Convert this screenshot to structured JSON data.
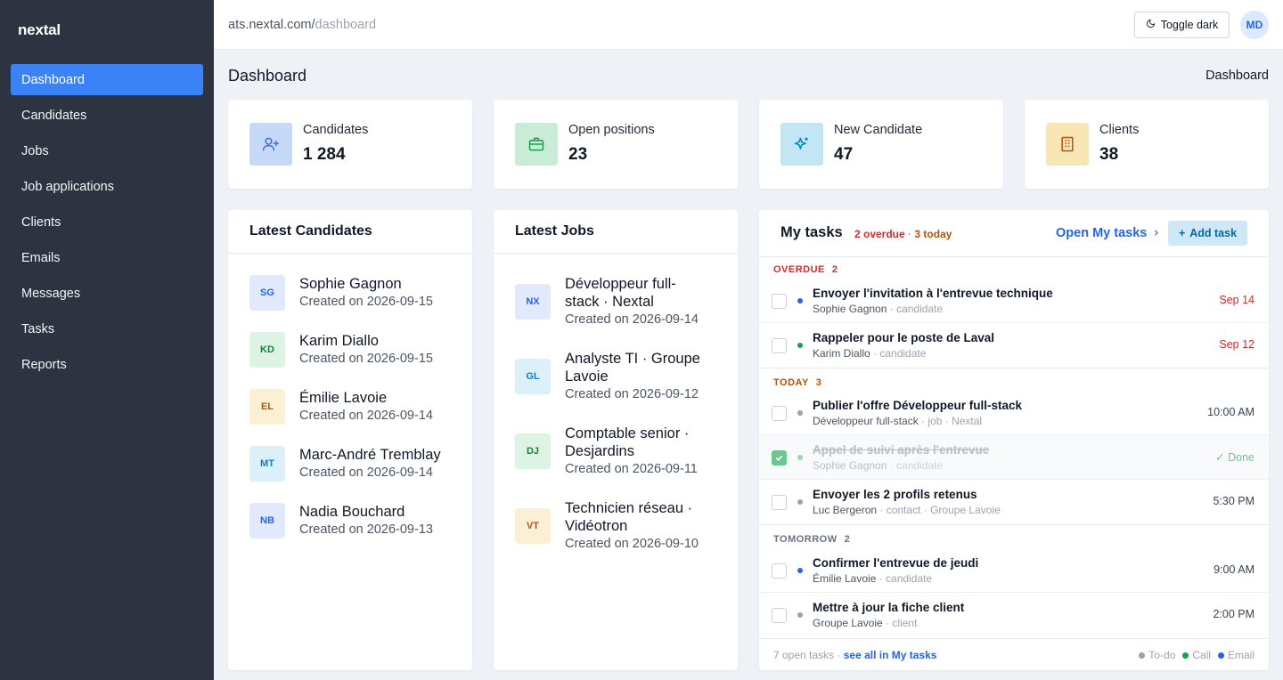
{
  "app": {
    "logo": "nextal"
  },
  "sidebar": {
    "items": [
      {
        "label": "Dashboard",
        "active": true
      },
      {
        "label": "Candidates"
      },
      {
        "label": "Jobs"
      },
      {
        "label": "Job applications"
      },
      {
        "label": "Clients"
      },
      {
        "label": "Emails"
      },
      {
        "label": "Messages"
      },
      {
        "label": "Tasks"
      },
      {
        "label": "Reports"
      }
    ]
  },
  "topbar": {
    "url_host": "ats.nextal.com/",
    "url_path": "dashboard",
    "toggle_label": "Toggle dark",
    "user_initials": "MD"
  },
  "page": {
    "title": "Dashboard",
    "breadcrumb": "Dashboard"
  },
  "stats": [
    {
      "label": "Candidates",
      "value": "1 284",
      "icon": "user-plus-icon",
      "bg": "#c7d9f8",
      "fg": "#3b6fd4"
    },
    {
      "label": "Open positions",
      "value": "23",
      "icon": "briefcase-icon",
      "bg": "#c8ecd6",
      "fg": "#16a34a"
    },
    {
      "label": "New Candidate",
      "value": "47",
      "icon": "sparkle-icon",
      "bg": "#c3e6f5",
      "fg": "#0284c7"
    },
    {
      "label": "Clients",
      "value": "38",
      "icon": "building-icon",
      "bg": "#f8e7b4",
      "fg": "#b45309"
    }
  ],
  "latest_candidates": {
    "title": "Latest Candidates",
    "items": [
      {
        "initials": "SG",
        "name": "Sophie Gagnon",
        "sub": "Created on 2026-09-15",
        "bg": "#e0eafc",
        "fg": "#2563eb"
      },
      {
        "initials": "KD",
        "name": "Karim Diallo",
        "sub": "Created on 2026-09-15",
        "bg": "#ddf3e4",
        "fg": "#15803d"
      },
      {
        "initials": "EL",
        "name": "Émilie Lavoie",
        "sub": "Created on 2026-09-14",
        "bg": "#fbf0d4",
        "fg": "#b45309"
      },
      {
        "initials": "MT",
        "name": "Marc-André Tremblay",
        "sub": "Created on 2026-09-14",
        "bg": "#dcf0fa",
        "fg": "#0284c7"
      },
      {
        "initials": "NB",
        "name": "Nadia Bouchard",
        "sub": "Created on 2026-09-13",
        "bg": "#e0eafc",
        "fg": "#2563eb"
      }
    ]
  },
  "latest_jobs": {
    "title": "Latest Jobs",
    "items": [
      {
        "initials": "NX",
        "line1": "Développeur full-",
        "line2": "stack · Nextal",
        "sub": "Created on 2026-09-14",
        "bg": "#e0eafc",
        "fg": "#2563eb"
      },
      {
        "initials": "GL",
        "line1": "Analyste TI · Groupe",
        "line2": "Lavoie",
        "sub": "Created on 2026-09-12",
        "bg": "#dcf0fa",
        "fg": "#0284c7"
      },
      {
        "initials": "DJ",
        "line1": "Comptable senior ·",
        "line2": "Desjardins",
        "sub": "Created on 2026-09-11",
        "bg": "#ddf3e4",
        "fg": "#15803d"
      },
      {
        "initials": "VT",
        "line1": "Technicien réseau ·",
        "line2": "Vidéotron",
        "sub": "Created on 2026-09-10",
        "bg": "#fbf0d4",
        "fg": "#b45309"
      }
    ]
  },
  "tasks": {
    "title": "My tasks",
    "overdue_count": "2 overdue",
    "sep": " · ",
    "today_count": "3 today",
    "open_link": "Open My tasks",
    "add_label": "Add task",
    "sections": [
      {
        "label": "OVERDUE",
        "count": "2",
        "color": "#dc2626"
      },
      {
        "label": "TODAY",
        "count": "3",
        "color": "#b45309"
      },
      {
        "label": "TOMORROW",
        "count": "2",
        "color": "#6b7280"
      }
    ],
    "items": [
      {
        "title": "Envoyer l'invitation à l'entrevue technique",
        "who": "Sophie Gagnon",
        "meta": " · candidate",
        "time": "Sep 14",
        "time_color": "#dc2626",
        "dot": "#2563eb"
      },
      {
        "title": "Rappeler pour le poste de Laval",
        "who": "Karim Diallo",
        "meta": " · candidate",
        "time": "Sep 12",
        "time_color": "#dc2626",
        "dot": "#16a34a"
      },
      {
        "title": "Publier l'offre Développeur full-stack",
        "who": "Développeur full-stack",
        "meta": " · job · Nextal",
        "time": "10:00 AM",
        "time_color": "#374151",
        "dot": "#9ca3af"
      },
      {
        "title": "Appel de suivi après l'entrevue",
        "who": "Sophie Gagnon",
        "meta": " · candidate",
        "time": "✓ Done",
        "time_color": "#6fc58f",
        "dot": "#9bd9b0",
        "done": true
      },
      {
        "title": "Envoyer les 2 profils retenus",
        "who": "Luc Bergeron",
        "meta": " · contact · Groupe Lavoie",
        "time": "5:30 PM",
        "time_color": "#374151",
        "dot": "#9ca3af"
      },
      {
        "title": "Confirmer l'entrevue de jeudi",
        "who": "Émilie Lavoie",
        "meta": " · candidate",
        "time": "9:00 AM",
        "time_color": "#374151",
        "dot": "#2563eb"
      },
      {
        "title": "Mettre à jour la fiche client",
        "who": "Groupe Lavoie",
        "meta": " · client",
        "time": "2:00 PM",
        "time_color": "#374151",
        "dot": "#9ca3af"
      }
    ],
    "footer_open": "7 open tasks · ",
    "footer_link": "see all in My tasks",
    "legend": [
      {
        "label": "To-do",
        "color": "#9ca3af"
      },
      {
        "label": "Call",
        "color": "#16a34a"
      },
      {
        "label": "Email",
        "color": "#2563eb"
      }
    ]
  }
}
